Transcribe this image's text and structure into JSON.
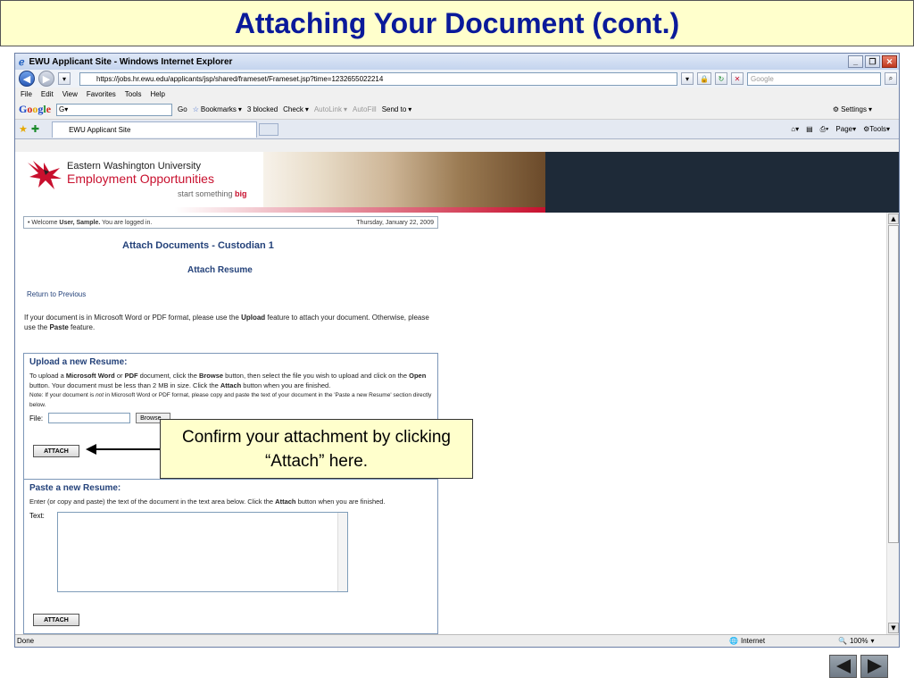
{
  "slide": {
    "title": "Attaching Your Document (cont.)"
  },
  "browser": {
    "window_title": "EWU Applicant Site - Windows Internet Explorer",
    "url": "https://jobs.hr.ewu.edu/applicants/jsp/shared/frameset/Frameset.jsp?time=1232655022214",
    "search_placeholder": "Google",
    "menu": [
      "File",
      "Edit",
      "View",
      "Favorites",
      "Tools",
      "Help"
    ],
    "google_toolbar": {
      "logo": "Google",
      "go": "Go",
      "bookmarks": "Bookmarks",
      "blocked": "3 blocked",
      "check": "Check",
      "autolink": "AutoLink",
      "autofill": "AutoFill",
      "send_to": "Send to",
      "settings": "Settings"
    },
    "tab_label": "EWU Applicant Site",
    "tab_tools": {
      "page": "Page",
      "tools": "Tools"
    },
    "status": {
      "left": "Done",
      "zone": "Internet",
      "zoom": "100%"
    }
  },
  "site": {
    "university": "Eastern Washington University",
    "department": "Employment Opportunities",
    "tagline_prefix": "start something ",
    "tagline_emphasis": "big",
    "welcome_prefix": "Welcome ",
    "welcome_user": "User, Sample.",
    "welcome_suffix": " You are logged in.",
    "date": "Thursday, January 22, 2009",
    "page_title": "Attach Documents - Custodian 1",
    "page_subtitle": "Attach Resume",
    "return_link": "Return to Previous",
    "intro_part1": "If your document is in Microsoft Word or PDF format, please use the ",
    "intro_upload": "Upload",
    "intro_part2": " feature to attach your document. Otherwise, please use the ",
    "intro_paste": "Paste",
    "intro_part3": " feature.",
    "upload": {
      "heading": "Upload a new Resume:",
      "p1": "To upload a ",
      "word": "Microsoft Word",
      "p2": " or ",
      "pdf": "PDF",
      "p3": " document, click the ",
      "browse": "Browse",
      "p4": " button, then select the file you wish to upload and click on the ",
      "open": "Open",
      "p5": " button. Your document must be less than 2 MB in size. Click the ",
      "attach": "Attach",
      "p6": " button when you are finished.",
      "note1": "Note: If your document is ",
      "note_not": "not",
      "note2": " in Microsoft Word or PDF format, please copy and paste the text of your document in the 'Paste a new Resume' section directly below.",
      "file_label": "File:",
      "browse_button": "Browse...",
      "attach_button": "ATTACH"
    },
    "paste": {
      "heading": "Paste a new Resume:",
      "p1": "Enter (or copy and paste) the text of the document in the text area below. Click the ",
      "attach": "Attach",
      "p2": " button when you are finished.",
      "text_label": "Text:",
      "attach_button": "ATTACH"
    }
  },
  "callout": {
    "text": "Confirm your attachment by clicking “Attach” here."
  },
  "colors": {
    "title_text": "#0a1a9a",
    "callout_bg": "#ffffcc",
    "ewu_red": "#c8102e",
    "ewu_heading": "#24427a"
  },
  "icons": [
    "ie-logo-icon",
    "back-icon",
    "forward-icon",
    "lock-icon",
    "refresh-icon",
    "stop-icon",
    "search-icon",
    "star-icon",
    "home-icon",
    "feeds-icon",
    "print-icon",
    "globe-icon",
    "zoom-icon",
    "prev-slide-icon",
    "next-slide-icon"
  ]
}
